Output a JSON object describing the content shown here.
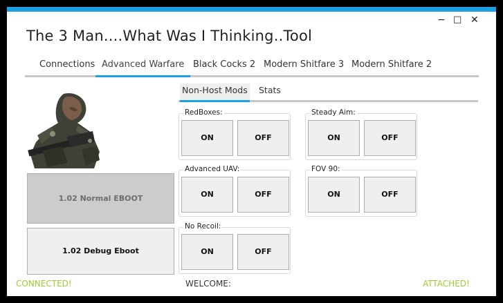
{
  "window": {
    "title": "The 3 Man....What Was I Thinking..Tool",
    "controls": {
      "minimize": "−",
      "maximize": "□",
      "close": "✕"
    }
  },
  "tabs": [
    "Connections",
    "Advanced Warfare",
    "Black Cocks 2",
    "Modern Shitfare 3",
    "Modern Shitfare 2"
  ],
  "active_tab": "Advanced Warfare",
  "left_panel": {
    "eboot_normal": "1.02 Normal EBOOT",
    "eboot_debug": "1.02 Debug Eboot"
  },
  "subtabs": [
    "Non-Host Mods",
    "Stats"
  ],
  "mods": [
    {
      "label": "RedBoxes:",
      "on": "ON",
      "off": "OFF"
    },
    {
      "label": "Steady Aim:",
      "on": "ON",
      "off": "OFF"
    },
    {
      "label": "Advanced UAV:",
      "on": "ON",
      "off": "OFF"
    },
    {
      "label": "FOV 90:",
      "on": "ON",
      "off": "OFF"
    },
    {
      "label": "No Recoil:",
      "on": "ON",
      "off": "OFF"
    }
  ],
  "status": {
    "connected": "CONNECTED!",
    "welcome": "WELCOME:",
    "attached": "ATTACHED!"
  },
  "colors": {
    "accent": "#1ba1e2",
    "status_green": "#9acd32"
  }
}
